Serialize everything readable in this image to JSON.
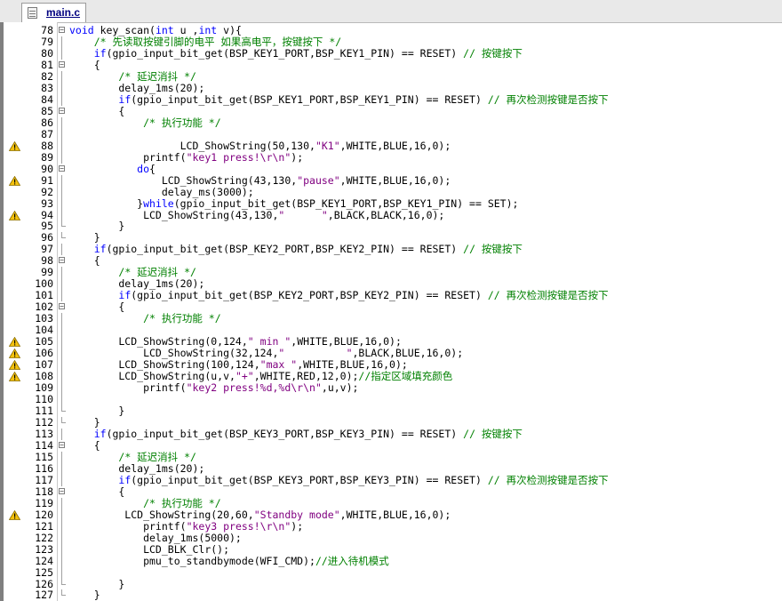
{
  "editor": {
    "tab_label": "main.c",
    "tab_icon": "c-file-icon",
    "warning_icon": "warning-triangle-icon"
  },
  "lines": [
    {
      "n": "78",
      "code": "void key_scan(int u ,int v){"
    },
    {
      "n": "79",
      "code": "    /* 先读取按键引脚的电平 如果高电平，按键按下 */"
    },
    {
      "n": "80",
      "code": "    if(gpio_input_bit_get(BSP_KEY1_PORT,BSP_KEY1_PIN) == RESET) // 按键按下"
    },
    {
      "n": "81",
      "code": "    {"
    },
    {
      "n": "82",
      "code": "        /* 延迟消抖 */"
    },
    {
      "n": "83",
      "code": "        delay_1ms(20);"
    },
    {
      "n": "84",
      "code": "        if(gpio_input_bit_get(BSP_KEY1_PORT,BSP_KEY1_PIN) == RESET) // 再次检测按键是否按下"
    },
    {
      "n": "85",
      "code": "        {"
    },
    {
      "n": "86",
      "code": "            /* 执行功能 */"
    },
    {
      "n": "87",
      "code": ""
    },
    {
      "n": "88",
      "code": "                  LCD_ShowString(50,130,\"K1\",WHITE,BLUE,16,0);",
      "warn": true
    },
    {
      "n": "89",
      "code": "            printf(\"key1 press!\\r\\n\");"
    },
    {
      "n": "90",
      "code": "           do{"
    },
    {
      "n": "91",
      "code": "               LCD_ShowString(43,130,\"pause\",WHITE,BLUE,16,0);",
      "warn": true
    },
    {
      "n": "92",
      "code": "               delay_ms(3000);"
    },
    {
      "n": "93",
      "code": "           }while(gpio_input_bit_get(BSP_KEY1_PORT,BSP_KEY1_PIN) == SET);"
    },
    {
      "n": "94",
      "code": "            LCD_ShowString(43,130,\"      \",BLACK,BLACK,16,0);",
      "warn": true
    },
    {
      "n": "95",
      "code": "        }"
    },
    {
      "n": "96",
      "code": "    }"
    },
    {
      "n": "97",
      "code": "    if(gpio_input_bit_get(BSP_KEY2_PORT,BSP_KEY2_PIN) == RESET) // 按键按下"
    },
    {
      "n": "98",
      "code": "    {"
    },
    {
      "n": "99",
      "code": "        /* 延迟消抖 */"
    },
    {
      "n": "100",
      "code": "        delay_1ms(20);"
    },
    {
      "n": "101",
      "code": "        if(gpio_input_bit_get(BSP_KEY2_PORT,BSP_KEY2_PIN) == RESET) // 再次检测按键是否按下"
    },
    {
      "n": "102",
      "code": "        {"
    },
    {
      "n": "103",
      "code": "            /* 执行功能 */"
    },
    {
      "n": "104",
      "code": ""
    },
    {
      "n": "105",
      "code": "        LCD_ShowString(0,124,\" min \",WHITE,BLUE,16,0);",
      "warn": true
    },
    {
      "n": "106",
      "code": "            LCD_ShowString(32,124,\"          \",BLACK,BLUE,16,0);",
      "warn": true
    },
    {
      "n": "107",
      "code": "        LCD_ShowString(100,124,\"max \",WHITE,BLUE,16,0);",
      "warn": true
    },
    {
      "n": "108",
      "code": "        LCD_ShowString(u,v,\"+\",WHITE,RED,12,0);//指定区域填充颜色",
      "warn": true
    },
    {
      "n": "109",
      "code": "            printf(\"key2 press!%d,%d\\r\\n\",u,v);"
    },
    {
      "n": "110",
      "code": ""
    },
    {
      "n": "111",
      "code": "        }"
    },
    {
      "n": "112",
      "code": "    }"
    },
    {
      "n": "113",
      "code": "    if(gpio_input_bit_get(BSP_KEY3_PORT,BSP_KEY3_PIN) == RESET) // 按键按下"
    },
    {
      "n": "114",
      "code": "    {"
    },
    {
      "n": "115",
      "code": "        /* 延迟消抖 */"
    },
    {
      "n": "116",
      "code": "        delay_1ms(20);"
    },
    {
      "n": "117",
      "code": "        if(gpio_input_bit_get(BSP_KEY3_PORT,BSP_KEY3_PIN) == RESET) // 再次检测按键是否按下"
    },
    {
      "n": "118",
      "code": "        {"
    },
    {
      "n": "119",
      "code": "            /* 执行功能 */"
    },
    {
      "n": "120",
      "code": "         LCD_ShowString(20,60,\"Standby mode\",WHITE,BLUE,16,0);",
      "warn": true
    },
    {
      "n": "121",
      "code": "            printf(\"key3 press!\\r\\n\");"
    },
    {
      "n": "122",
      "code": "            delay_1ms(5000);"
    },
    {
      "n": "123",
      "code": "            LCD_BLK_Clr();"
    },
    {
      "n": "124",
      "code": "            pmu_to_standbymode(WFI_CMD);//进入待机模式"
    },
    {
      "n": "125",
      "code": ""
    },
    {
      "n": "126",
      "code": "        }"
    },
    {
      "n": "127",
      "code": "    }"
    }
  ]
}
